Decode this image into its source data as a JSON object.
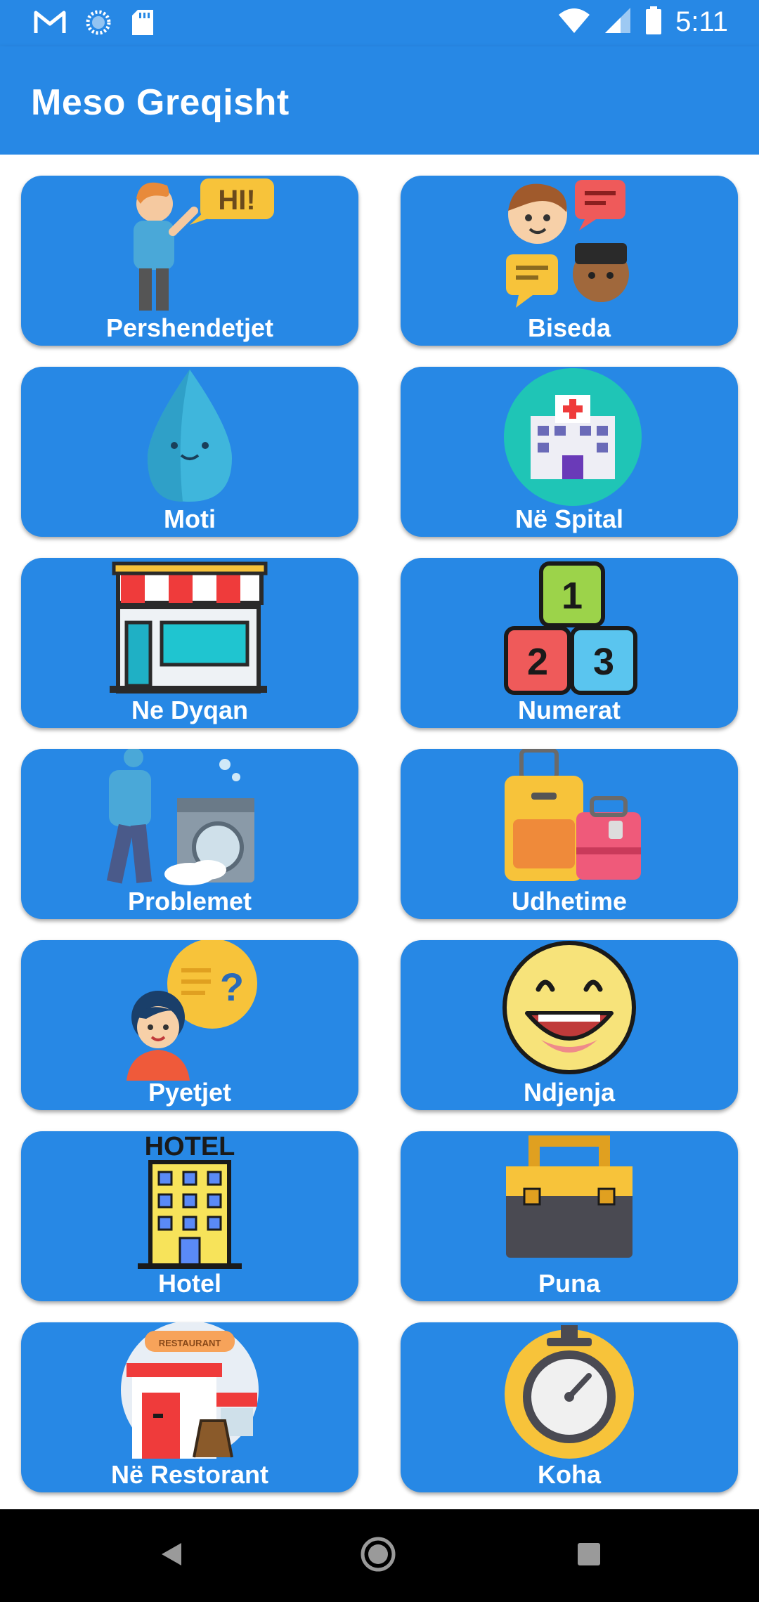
{
  "status_bar": {
    "time": "5:11",
    "icons_left": [
      "gmail-icon",
      "sync-icon",
      "sd-card-icon"
    ],
    "icons_right": [
      "wifi-icon",
      "signal-icon",
      "battery-icon"
    ]
  },
  "app_bar": {
    "title": "Meso Greqisht"
  },
  "categories": [
    {
      "label": "Pershendetjet",
      "icon": "greeting-person-icon"
    },
    {
      "label": "Biseda",
      "icon": "conversation-icon"
    },
    {
      "label": "Moti",
      "icon": "water-drop-icon"
    },
    {
      "label": "Në Spital",
      "icon": "hospital-icon"
    },
    {
      "label": "Ne Dyqan",
      "icon": "shop-icon"
    },
    {
      "label": "Numerat",
      "icon": "number-blocks-icon"
    },
    {
      "label": "Problemet",
      "icon": "washing-machine-icon"
    },
    {
      "label": "Udhetime",
      "icon": "luggage-icon"
    },
    {
      "label": "Pyetjet",
      "icon": "question-person-icon"
    },
    {
      "label": "Ndjenja",
      "icon": "smiley-icon"
    },
    {
      "label": "Hotel",
      "icon": "hotel-icon"
    },
    {
      "label": "Puna",
      "icon": "toolbox-icon"
    },
    {
      "label": "Në Restorant",
      "icon": "restaurant-icon"
    },
    {
      "label": "Koha",
      "icon": "stopwatch-icon"
    }
  ],
  "colors": {
    "primary": "#2788e5",
    "card": "#2788e5",
    "text_on_primary": "#ffffff",
    "nav_bar": "#000000"
  },
  "nav_bar": {
    "buttons": [
      "back-icon",
      "home-icon",
      "recents-icon"
    ]
  }
}
